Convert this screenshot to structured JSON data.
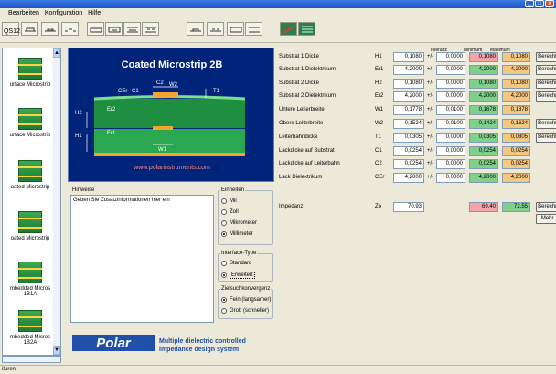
{
  "window": {
    "minimize": "_",
    "maximize": "□",
    "close": "x"
  },
  "menu": [
    "Bearbeiten",
    "Konfiguration",
    "Hilfe"
  ],
  "toolbar": {
    "label": "QS12"
  },
  "left_list": {
    "items": [
      "urface Microstrip",
      "urface Microstrip",
      "oated Microstrip",
      "oated Microstrip",
      "mbedded Micros\n1B1A",
      "mbedded Micros\n1B2A"
    ]
  },
  "diagram": {
    "title": "Coated Microstrip 2B",
    "url": "www.polarinstruments.com",
    "labels": {
      "c2": "C2",
      "w2": "W2",
      "cer": "CEr",
      "c1": "C1",
      "t1": "T1",
      "h2": "H2",
      "er2": "Er2",
      "h1": "H1",
      "er1": "Er1",
      "w1": "W1"
    }
  },
  "hinweise": {
    "label": "Hinweise",
    "text": "Geben Sie Zusatzinformationen hier ein"
  },
  "einheiten": {
    "title": "Einheiten",
    "options": [
      "Mil",
      "Zoll",
      "Mikrometer",
      "Millimeter"
    ],
    "selected": 3
  },
  "interface": {
    "title": "Interface-Type",
    "options": [
      "Standard",
      "Erweitert"
    ],
    "selected": 1
  },
  "ziel": {
    "title": "Zielsuchkonvergenz",
    "options": [
      "Fein (langsamer)",
      "Grob (schneller)"
    ],
    "selected": 0
  },
  "brand": {
    "logo": "Polar",
    "tagline_1": "Multiple dielectric controlled",
    "tagline_2": "impedance design system"
  },
  "columns": {
    "toleranz": "Toleranz",
    "minimum": "Minimum",
    "maximum": "Maximum"
  },
  "params": [
    {
      "name": "Substrat 1 Dicke",
      "sym": "H1",
      "value": "0,1080",
      "pm": "+/-",
      "tol": "0,0000",
      "min": "0,1080",
      "max": "0,1080",
      "btn": "Berechne",
      "minred": true
    },
    {
      "name": "Substrat 1 Dielektrikum",
      "sym": "Er1",
      "value": "4,2000",
      "pm": "+/-",
      "tol": "0,0000",
      "min": "4,2000",
      "max": "4,2000",
      "btn": "Berechne",
      "minred": false
    },
    {
      "name": "Substrat 2 Dicke",
      "sym": "H2",
      "value": "0,1080",
      "pm": "+/-",
      "tol": "0,0000",
      "min": "0,1080",
      "max": "0,1080",
      "btn": "Berechne",
      "minred": false
    },
    {
      "name": "Substrat 2 Dielektrikum",
      "sym": "Er2",
      "value": "4,2000",
      "pm": "+/-",
      "tol": "0,0000",
      "min": "4,2000",
      "max": "4,2000",
      "btn": "Berechne",
      "minred": false
    },
    {
      "name": "Untere Leiterbreite",
      "sym": "W1",
      "value": "0,1778",
      "pm": "+/-",
      "tol": "0,0100",
      "min": "0,1678",
      "max": "0,1878",
      "btn": "",
      "minred": false
    },
    {
      "name": "Obere Leiterbreite",
      "sym": "W2",
      "value": "0,1524",
      "pm": "+/-",
      "tol": "0,0100",
      "min": "0,1424",
      "max": "0,1624",
      "btn": "Berechne",
      "minred": false
    },
    {
      "name": "Leiterbahndicke",
      "sym": "T1",
      "value": "0,0305",
      "pm": "+/-",
      "tol": "0,0000",
      "min": "0,0305",
      "max": "0,0305",
      "btn": "Berechne",
      "minred": false
    },
    {
      "name": "Lackdicke auf Substrat",
      "sym": "C1",
      "value": "0,0254",
      "pm": "+/-",
      "tol": "0,0000",
      "min": "0,0254",
      "max": "0,0254",
      "btn": "",
      "minred": false
    },
    {
      "name": "Lackdicke auf Leiterbahn",
      "sym": "C2",
      "value": "0,0254",
      "pm": "+/-",
      "tol": "0,0000",
      "min": "0,0254",
      "max": "0,0254",
      "btn": "",
      "minred": false
    },
    {
      "name": "Lack Dielektrikum",
      "sym": "CEr",
      "value": "4,2000",
      "pm": "+/-",
      "tol": "0,0000",
      "min": "4,2000",
      "max": "4,2000",
      "btn": "",
      "minred": false
    }
  ],
  "impedanz": {
    "name": "Impedanz",
    "sym": "Zo",
    "value": "70,93",
    "min": "69,40",
    "max": "72,55",
    "btn": "Berechne",
    "more": "Mehr..."
  },
  "status": "ituren"
}
